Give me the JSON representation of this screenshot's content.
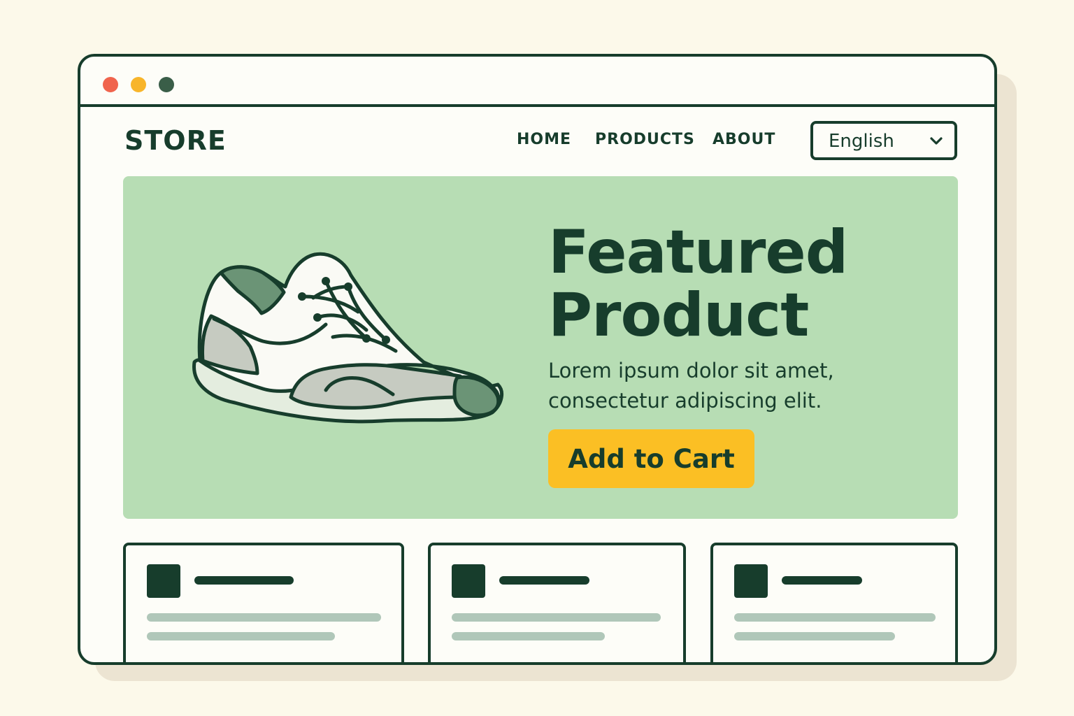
{
  "window": {
    "controls": [
      "close",
      "minimize",
      "maximize"
    ]
  },
  "header": {
    "brand": "STORE",
    "nav": [
      {
        "label": "HOME"
      },
      {
        "label": "PRODUCTS"
      },
      {
        "label": "ABOUT"
      }
    ],
    "language_select": {
      "value": "English",
      "icon": "chevron-down-icon"
    }
  },
  "hero": {
    "title_lines": [
      "Featured",
      "Product"
    ],
    "description_lines": [
      "Lorem ipsum dolor sit amet,",
      "consectetur adipiscing elit."
    ],
    "cta_label": "Add to Cart",
    "image": "sneaker-illustration"
  },
  "product_cards": [
    {
      "placeholder": true
    },
    {
      "placeholder": true
    },
    {
      "placeholder": true
    }
  ],
  "colors": {
    "page_background": "#fcf9ea",
    "ink": "#173d2c",
    "hero_background": "#b7ddb4",
    "cta_background": "#fbbf24",
    "skeleton_text": "#b0c7b9",
    "dot_red": "#f0644d",
    "dot_yellow": "#f8b52a",
    "dot_green": "#3a5e48"
  }
}
